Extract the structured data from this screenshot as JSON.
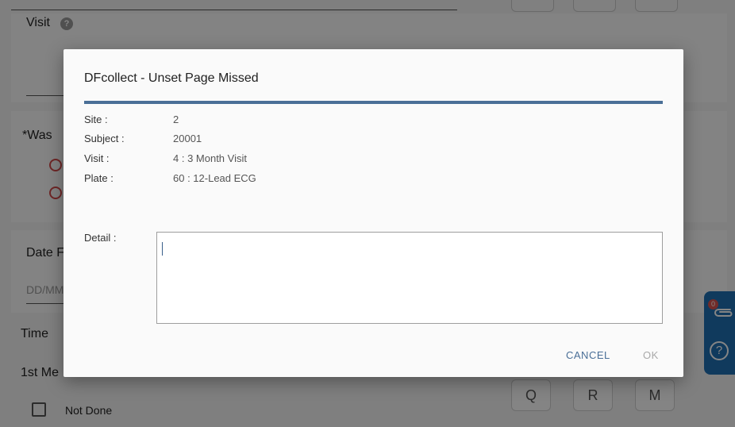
{
  "background_form": {
    "visit_label": "Visit",
    "visit_help_glyph": "?",
    "question_prefix": "*Was",
    "date_label": "Date F",
    "date_placeholder": "DD/MM",
    "time_label": "Time",
    "measurement_label": "1st Me",
    "not_done_label": "Not Done",
    "field_buttons": [
      "Q",
      "R",
      "M"
    ]
  },
  "side_panel": {
    "attachments_badge": "0",
    "attachment_icon": "paperclip-icon",
    "help_glyph": "?",
    "color": "#1f6fb3"
  },
  "dialog": {
    "title": "DFcollect - Unset Page Missed",
    "accent_color": "#4a6f97",
    "info": [
      {
        "key": "Site :",
        "value": "2"
      },
      {
        "key": "Subject :",
        "value": "20001"
      },
      {
        "key": "Visit :",
        "value": "4 : 3 Month Visit"
      },
      {
        "key": "Plate :",
        "value": "60 : 12-Lead ECG"
      }
    ],
    "detail_label": "Detail :",
    "detail_value": "",
    "cancel_label": "CANCEL",
    "ok_label": "OK"
  }
}
